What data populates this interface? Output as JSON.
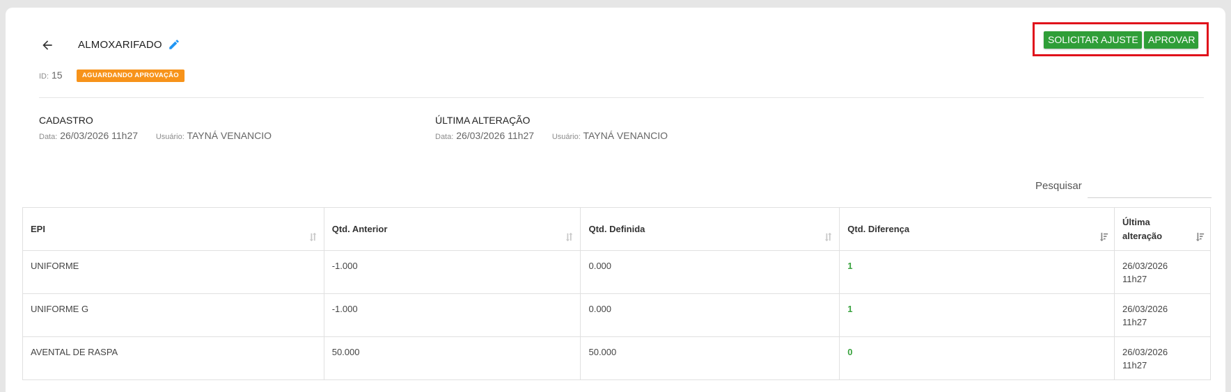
{
  "header": {
    "title": "ALMOXARIFADO",
    "back_icon": "arrow-left-icon",
    "edit_icon": "pencil-icon",
    "id_label": "ID:",
    "id_value": "15",
    "status": "AGUARDANDO APROVAÇÃO",
    "status_color": "#f7931a"
  },
  "actions": {
    "request_adjust": "SOLICITAR AJUSTE",
    "approve": "APROVAR",
    "button_color": "#2f9e38"
  },
  "meta": {
    "cadastro": {
      "title": "CADASTRO",
      "date_label": "Data:",
      "date": "26/03/2026 11h27",
      "user_label": "Usuário:",
      "user": "TAYNÁ VENANCIO"
    },
    "alteracao": {
      "title": "ÚLTIMA ALTERAÇÃO",
      "date_label": "Data:",
      "date": "26/03/2026 11h27",
      "user_label": "Usuário:",
      "user": "TAYNÁ VENANCIO"
    }
  },
  "search": {
    "label": "Pesquisar",
    "value": ""
  },
  "table": {
    "columns": [
      {
        "label": "EPI",
        "sort": "unsorted"
      },
      {
        "label": "Qtd. Anterior",
        "sort": "unsorted"
      },
      {
        "label": "Qtd. Definida",
        "sort": "unsorted"
      },
      {
        "label": "Qtd. Diferença",
        "sort": "descending"
      },
      {
        "label": "Última alteração",
        "sort": "descending"
      }
    ],
    "rows": [
      {
        "epi": "UNIFORME",
        "anterior": "-1.000",
        "definida": "0.000",
        "diferenca": "1",
        "date": "26/03/2026",
        "time": "11h27"
      },
      {
        "epi": "UNIFORME G",
        "anterior": "-1.000",
        "definida": "0.000",
        "diferenca": "1",
        "date": "26/03/2026",
        "time": "11h27"
      },
      {
        "epi": "AVENTAL DE RASPA",
        "anterior": "50.000",
        "definida": "50.000",
        "diferenca": "0",
        "date": "26/03/2026",
        "time": "11h27"
      }
    ]
  }
}
